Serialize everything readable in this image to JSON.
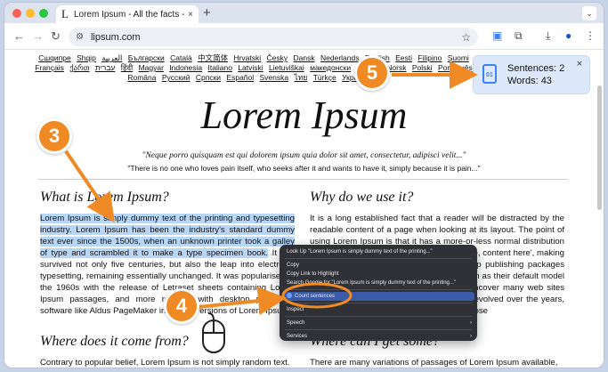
{
  "browser": {
    "tab_title": "Lorem Ipsum - All the facts - Li",
    "tab_close": "×",
    "new_tab": "+",
    "url": "lipsum.com",
    "favicon": "L",
    "tab_menu_glyph": "⌄"
  },
  "nav": {
    "back": "←",
    "forward": "→",
    "reload": "↻"
  },
  "languages": [
    "Cшqипре",
    "Shqip",
    "العربية",
    "Български",
    "Català",
    "中文简体",
    "Hrvatski",
    "Česky",
    "Dansk",
    "Nederlands",
    "English",
    "Eesti",
    "Filipino",
    "Suomi",
    "Français",
    "ქართ",
    "עברית",
    "हिंदी",
    "Magyar",
    "Indonesia",
    "Italiano",
    "Latviski",
    "Lietuviškai",
    "македонски",
    "Melayu",
    "Norsk",
    "Polski",
    "Português",
    "Româna",
    "Pyccкий",
    "Српски",
    "Español",
    "Svenska",
    "ไทย",
    "Türkçe",
    "Українська"
  ],
  "page": {
    "logo": "Lorem Ipsum",
    "quote": "\"Neque porro quisquam est qui dolorem ipsum quia dolor sit amet, consectetur, adipisci velit...\"",
    "quote_translation": "\"There is no one who loves pain itself, who seeks after it and wants to have it, simply because it is pain...\"",
    "what_heading": "What is Lorem Ipsum?",
    "what_selected": "Lorem Ipsum is simply dummy text of the printing and typesetting industry. Lorem Ipsum has been the industry's standard dummy text ever since the 1500s, when an unknown printer took a galley of type and scrambled it to make a type specimen book.",
    "what_rest": " It has survived not only five centuries, but also the leap into electronic typesetting, remaining essentially unchanged. It was popularised in the 1960s with the release of Letraset sheets containing Lorem Ipsum passages, and more recently with desktop publishing software like Aldus PageMaker including versions of Lorem Ipsum.",
    "why_heading": "Why do we use it?",
    "why_text": "It is a long established fact that a reader will be distracted by the readable content of a page when looking at its layout. The point of using Lorem Ipsum is that it has a more-or-less normal distribution of letters, as opposed to using 'Content here, content here', making it look like readable English. Many desktop publishing packages and web page editors now use Lorem Ipsum as their default model text, and a search for 'lorem ipsum' will uncover many web sites still in their infancy. Various versions have evolved over the years, sometimes by accident, sometimes on purpose",
    "where_heading": "Where does it come from?",
    "where_text": "Contrary to popular belief, Lorem Ipsum is not simply random text.",
    "get_heading": "Where can I get some?",
    "get_text": "There are many variations of passages of Lorem Ipsum available,"
  },
  "context_menu": {
    "items": [
      {
        "label": "Look Up \"Lorem Ipsum is simply dummy text of the printing...\""
      },
      {
        "label": "Copy"
      },
      {
        "label": "Copy Link to Highlight"
      },
      {
        "label": "Search Google for \"Lorem Ipsum is simply dummy text of the printing...\""
      },
      {
        "label": "Count sentences"
      },
      {
        "label": "Inspect"
      },
      {
        "label": "Speech"
      },
      {
        "label": "Services"
      }
    ]
  },
  "popup": {
    "sentences": "Sentences: 2",
    "words": "Words: 43",
    "close": "×",
    "icon_text": "01"
  },
  "annotations": {
    "step3": "3",
    "step4": "4",
    "step5": "5"
  },
  "colors": {
    "accent": "#f08a24",
    "selection": "#b8d6f7",
    "menu_bg": "#2f3136",
    "popup_bg": "#dde9fa"
  }
}
